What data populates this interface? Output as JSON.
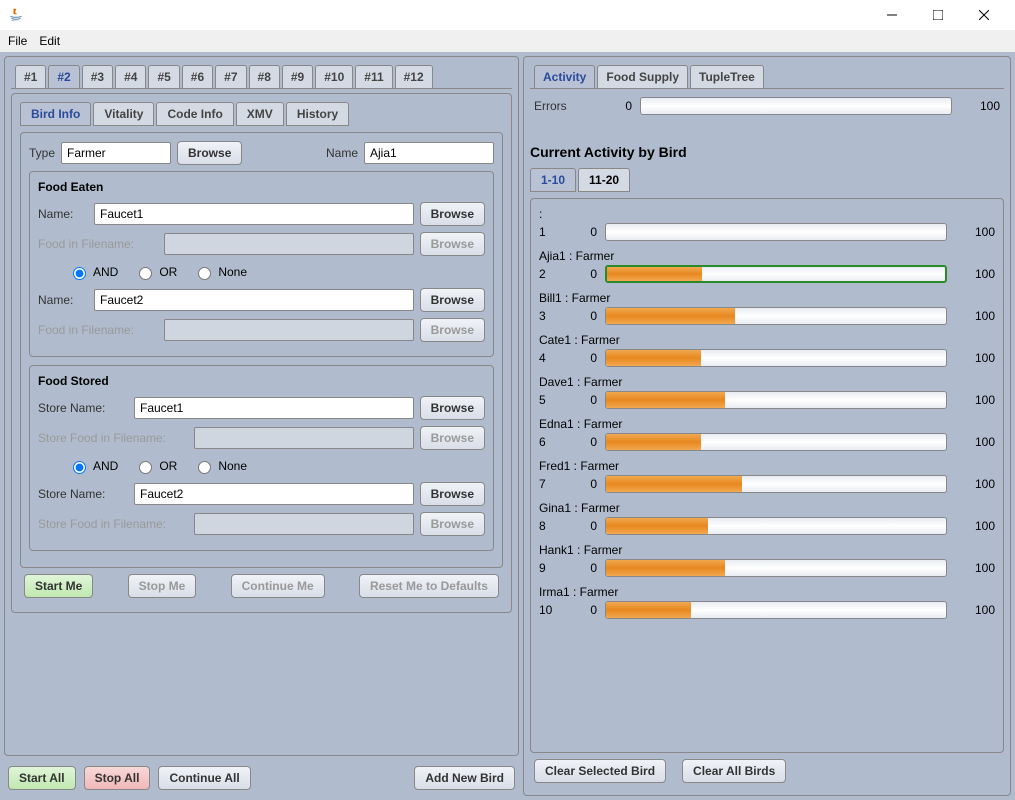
{
  "titlebar": {
    "title": ""
  },
  "menubar": {
    "file": "File",
    "edit": "Edit"
  },
  "leftTabs": [
    "#1",
    "#2",
    "#3",
    "#4",
    "#5",
    "#6",
    "#7",
    "#8",
    "#9",
    "#10",
    "#11",
    "#12"
  ],
  "leftActiveTab": 1,
  "subTabs": [
    "Bird Info",
    "Vitality",
    "Code Info",
    "XMV",
    "History"
  ],
  "subActiveTab": 0,
  "birdInfo": {
    "typeLabel": "Type",
    "typeValue": "Farmer",
    "typeBrowse": "Browse",
    "nameLabel": "Name",
    "nameValue": "Ajia1"
  },
  "foodEaten": {
    "title": "Food Eaten",
    "name1Label": "Name:",
    "name1Value": "Faucet1",
    "browse": "Browse",
    "fif1Label": "Food in Filename:",
    "fif1Value": "",
    "radio": {
      "and": "AND",
      "or": "OR",
      "none": "None",
      "selected": "and"
    },
    "name2Label": "Name:",
    "name2Value": "Faucet2",
    "fif2Label": "Food in Filename:",
    "fif2Value": ""
  },
  "foodStored": {
    "title": "Food Stored",
    "name1Label": "Store Name:",
    "name1Value": "Faucet1",
    "browse": "Browse",
    "fif1Label": "Store Food in Filename:",
    "fif1Value": "",
    "radio": {
      "and": "AND",
      "or": "OR",
      "none": "None",
      "selected": "and"
    },
    "name2Label": "Store Name:",
    "name2Value": "Faucet2",
    "fif2Label": "Store Food in Filename:",
    "fif2Value": ""
  },
  "leftButtons": {
    "startMe": "Start Me",
    "stopMe": "Stop Me",
    "continueMe": "Continue Me",
    "resetMe": "Reset Me to Defaults"
  },
  "globalButtons": {
    "startAll": "Start All",
    "stopAll": "Stop All",
    "continueAll": "Continue All",
    "addNewBird": "Add New Bird"
  },
  "rightTabs": [
    "Activity",
    "Food Supply",
    "TupleTree"
  ],
  "rightActiveTab": 0,
  "errors": {
    "label": "Errors",
    "min": "0",
    "max": "100",
    "value": 0
  },
  "activityHeader": "Current Activity by Bird",
  "rangeTabs": [
    "1-10",
    "11-20"
  ],
  "rangeActiveTab": 0,
  "birds": [
    {
      "num": "1",
      "label": ":",
      "min": "0",
      "max": "100",
      "progress": 0,
      "highlight": false
    },
    {
      "num": "2",
      "label": "Ajia1 : Farmer",
      "min": "0",
      "max": "100",
      "progress": 28,
      "highlight": true
    },
    {
      "num": "3",
      "label": "Bill1 : Farmer",
      "min": "0",
      "max": "100",
      "progress": 38,
      "highlight": false
    },
    {
      "num": "4",
      "label": "Cate1 : Farmer",
      "min": "0",
      "max": "100",
      "progress": 28,
      "highlight": false
    },
    {
      "num": "5",
      "label": "Dave1 : Farmer",
      "min": "0",
      "max": "100",
      "progress": 35,
      "highlight": false
    },
    {
      "num": "6",
      "label": "Edna1 : Farmer",
      "min": "0",
      "max": "100",
      "progress": 28,
      "highlight": false
    },
    {
      "num": "7",
      "label": "Fred1 : Farmer",
      "min": "0",
      "max": "100",
      "progress": 40,
      "highlight": false
    },
    {
      "num": "8",
      "label": "Gina1 : Farmer",
      "min": "0",
      "max": "100",
      "progress": 30,
      "highlight": false
    },
    {
      "num": "9",
      "label": "Hank1 : Farmer",
      "min": "0",
      "max": "100",
      "progress": 35,
      "highlight": false
    },
    {
      "num": "10",
      "label": "Irma1 : Farmer",
      "min": "0",
      "max": "100",
      "progress": 25,
      "highlight": false
    }
  ],
  "rightButtons": {
    "clearSelected": "Clear Selected Bird",
    "clearAll": "Clear All Birds"
  }
}
